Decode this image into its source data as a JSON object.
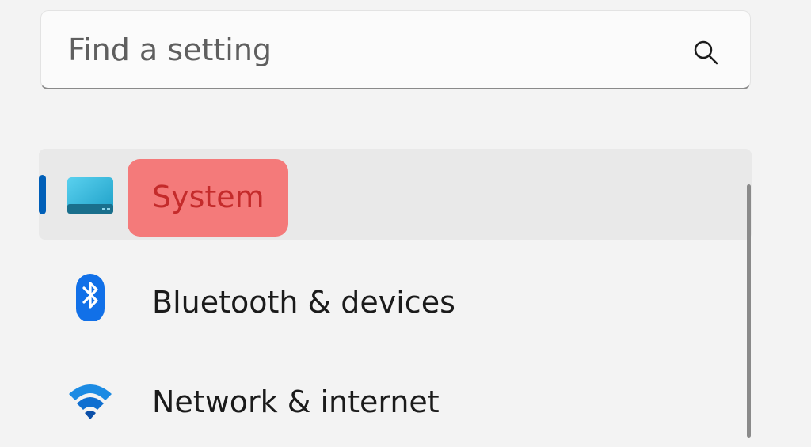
{
  "search": {
    "placeholder": "Find a setting",
    "value": ""
  },
  "nav": {
    "items": [
      {
        "label": "System",
        "icon": "monitor-icon",
        "selected": true
      },
      {
        "label": "Bluetooth & devices",
        "icon": "bluetooth-icon",
        "selected": false
      },
      {
        "label": "Network & internet",
        "icon": "wifi-icon",
        "selected": false
      }
    ]
  },
  "colors": {
    "accent": "#005fb8",
    "highlight": "#f47a7a",
    "highlight_text": "#c42b2b"
  }
}
